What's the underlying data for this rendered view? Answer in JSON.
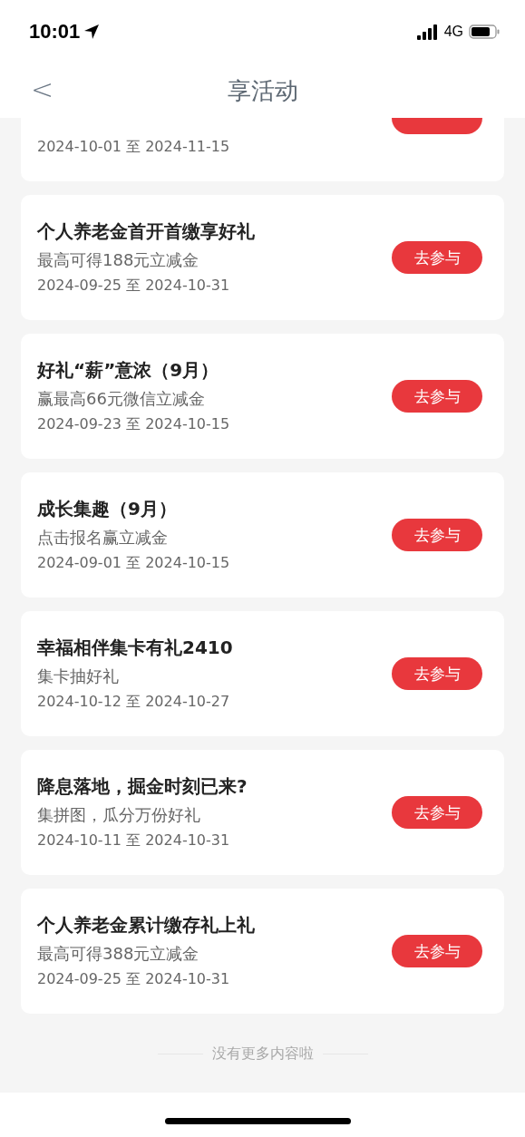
{
  "status_bar": {
    "time": "10:01",
    "network": "4G"
  },
  "header": {
    "back": "<",
    "title": "享活动"
  },
  "activities": [
    {
      "dates": "2024-10-01 至 2024-11-15"
    },
    {
      "title": "个人养老金首开首缴享好礼",
      "subtitle": "最高可得188元立减金",
      "dates": "2024-09-25 至 2024-10-31",
      "button": "去参与"
    },
    {
      "title": "好礼“薪”意浓（9月）",
      "subtitle": "赢最高66元微信立减金",
      "dates": "2024-09-23 至 2024-10-15",
      "button": "去参与"
    },
    {
      "title": "成长集趣（9月）",
      "subtitle": "点击报名赢立减金",
      "dates": "2024-09-01 至 2024-10-15",
      "button": "去参与"
    },
    {
      "title": "幸福相伴集卡有礼2410",
      "subtitle": "集卡抽好礼",
      "dates": "2024-10-12 至 2024-10-27",
      "button": "去参与"
    },
    {
      "title": "降息落地，掘金时刻已来?",
      "subtitle": "集拼图，瓜分万份好礼",
      "dates": "2024-10-11 至 2024-10-31",
      "button": "去参与"
    },
    {
      "title": "个人养老金累计缴存礼上礼",
      "subtitle": "最高可得388元立减金",
      "dates": "2024-09-25 至 2024-10-31",
      "button": "去参与"
    }
  ],
  "end_note": "没有更多内容啦"
}
